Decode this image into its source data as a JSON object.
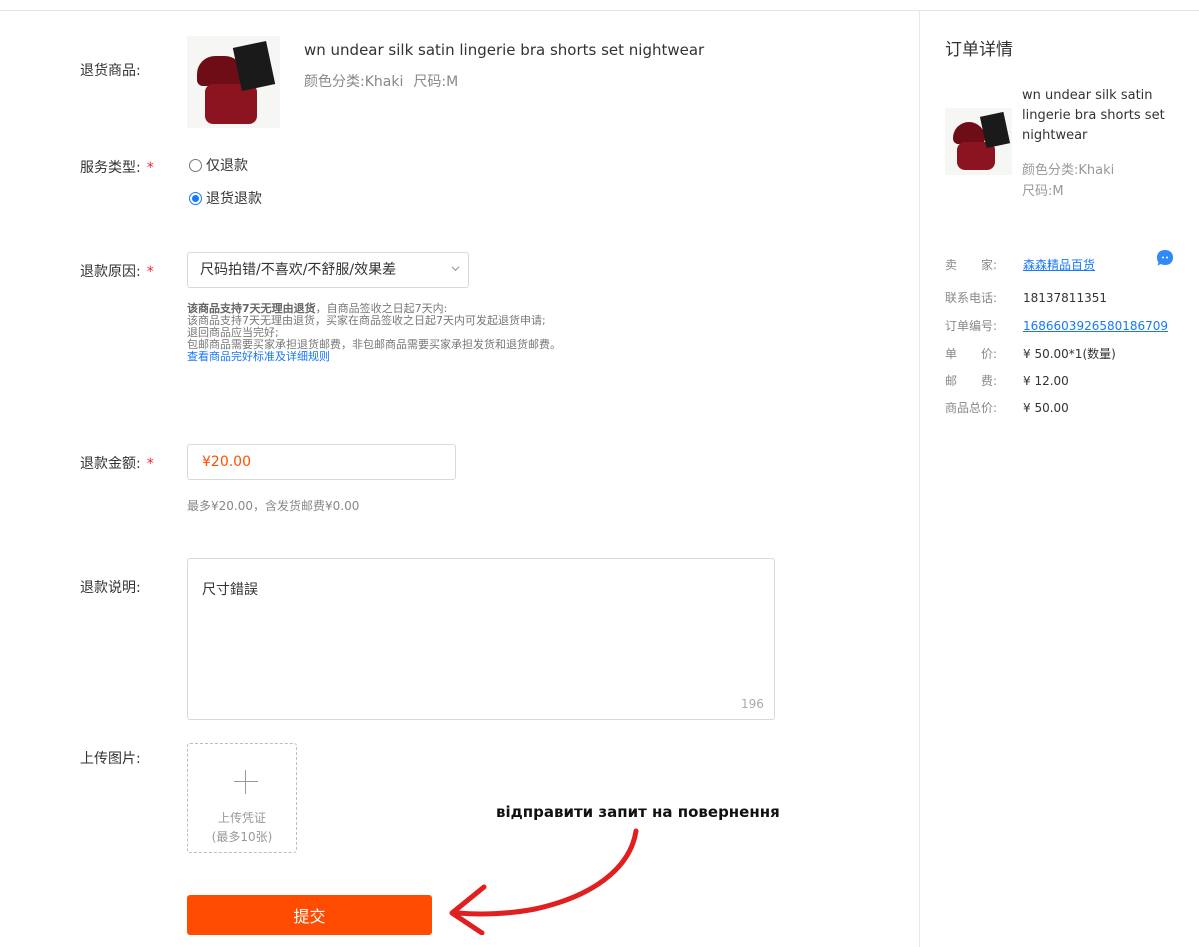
{
  "form": {
    "product_label": "退货商品:",
    "product": {
      "title": "wn undear silk satin lingerie bra shorts set nightwear",
      "color": "颜色分类:Khaki",
      "size": "尺码:M"
    },
    "service_label": "服务类型:",
    "service_options": [
      {
        "label": "仅退款",
        "checked": false
      },
      {
        "label": "退货退款",
        "checked": true
      }
    ],
    "reason_label": "退款原因:",
    "reason_value": "尺码拍错/不喜欢/不舒服/效果差",
    "policy": {
      "bold": "该商品支持7天无理由退货",
      "line1_rest": "，自商品签收之日起7天内:",
      "line2": "该商品支持7天无理由退货，买家在商品签收之日起7天内可发起退货申请;",
      "line3": "退回商品应当完好;",
      "line4": "包邮商品需要买家承担退货邮费，非包邮商品需要买家承担发货和退货邮费。",
      "link": "查看商品完好标准及详细规则"
    },
    "amount_label": "退款金额:",
    "amount_value": "¥20.00",
    "amount_hint": "最多¥20.00，含发货邮费¥0.00",
    "desc_label": "退款说明:",
    "desc_value": "尺寸錯誤",
    "desc_counter": "196",
    "upload_label": "上传图片:",
    "upload_line1": "上传凭证",
    "upload_line2": "(最多10张)",
    "submit_label": "提交",
    "required_mark": "*"
  },
  "annotation": {
    "text": "відправити запит на повернення",
    "color": "#e02020"
  },
  "order": {
    "title": "订单详情",
    "product_title": "wn undear silk satin lingerie bra shorts set nightwear",
    "color": "颜色分类:Khaki",
    "size": "尺码:M",
    "rows": [
      {
        "key": "卖　　家:",
        "value": "森森精品百货",
        "link": true
      },
      {
        "key": "联系电话:",
        "value": "18137811351",
        "link": false
      },
      {
        "key": "订单编号:",
        "value": "1686603926580186709",
        "link": true
      },
      {
        "key": "单　　价:",
        "value": "¥ 50.00*1(数量)",
        "link": false
      },
      {
        "key": "邮　　费:",
        "value": "¥ 12.00",
        "link": false
      },
      {
        "key": "商品总价:",
        "value": "¥ 50.00",
        "link": false
      }
    ]
  },
  "colors": {
    "accent": "#ff4c00",
    "link": "#1677ff",
    "required": "#f5222d"
  },
  "icons": {
    "chat": "chat-bubble-icon",
    "chevron": "chevron-down-icon",
    "plus": "plus-icon",
    "arrow": "hand-drawn-arrow-icon"
  }
}
